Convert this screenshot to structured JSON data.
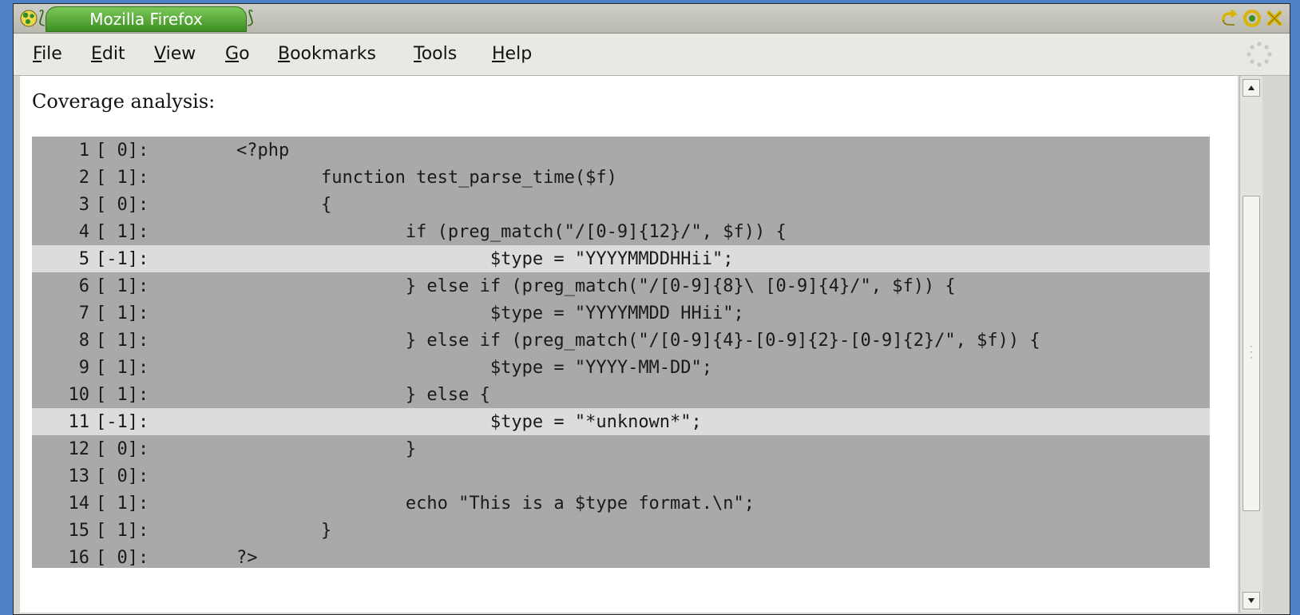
{
  "window": {
    "title": "Mozilla Firefox"
  },
  "menubar": {
    "items": [
      {
        "mnemonic": "F",
        "rest": "ile"
      },
      {
        "mnemonic": "E",
        "rest": "dit"
      },
      {
        "mnemonic": "V",
        "rest": "iew"
      },
      {
        "mnemonic": "G",
        "rest": "o"
      },
      {
        "mnemonic": "B",
        "rest": "ookmarks"
      },
      {
        "mnemonic": "T",
        "rest": "ools"
      },
      {
        "mnemonic": "H",
        "rest": "elp"
      }
    ]
  },
  "page": {
    "heading": "Coverage analysis:",
    "rows": [
      {
        "line": "1",
        "count": "[ 0]:",
        "code": "<?php",
        "uncovered": false
      },
      {
        "line": "2",
        "count": "[ 1]:",
        "code": "        function test_parse_time($f)",
        "uncovered": false
      },
      {
        "line": "3",
        "count": "[ 0]:",
        "code": "        {",
        "uncovered": false
      },
      {
        "line": "4",
        "count": "[ 1]:",
        "code": "                if (preg_match(\"/[0-9]{12}/\", $f)) {",
        "uncovered": false
      },
      {
        "line": "5",
        "count": "[-1]:",
        "code": "                        $type = \"YYYYMMDDHHii\";",
        "uncovered": true
      },
      {
        "line": "6",
        "count": "[ 1]:",
        "code": "                } else if (preg_match(\"/[0-9]{8}\\ [0-9]{4}/\", $f)) {",
        "uncovered": false
      },
      {
        "line": "7",
        "count": "[ 1]:",
        "code": "                        $type = \"YYYYMMDD HHii\";",
        "uncovered": false
      },
      {
        "line": "8",
        "count": "[ 1]:",
        "code": "                } else if (preg_match(\"/[0-9]{4}-[0-9]{2}-[0-9]{2}/\", $f)) {",
        "uncovered": false
      },
      {
        "line": "9",
        "count": "[ 1]:",
        "code": "                        $type = \"YYYY-MM-DD\";",
        "uncovered": false
      },
      {
        "line": "10",
        "count": "[ 1]:",
        "code": "                } else {",
        "uncovered": false
      },
      {
        "line": "11",
        "count": "[-1]:",
        "code": "                        $type = \"*unknown*\";",
        "uncovered": true
      },
      {
        "line": "12",
        "count": "[ 0]:",
        "code": "                }",
        "uncovered": false
      },
      {
        "line": "13",
        "count": "[ 0]:",
        "code": "",
        "uncovered": false
      },
      {
        "line": "14",
        "count": "[ 1]:",
        "code": "                echo \"This is a $type format.\\n\";",
        "uncovered": false
      },
      {
        "line": "15",
        "count": "[ 1]:",
        "code": "        }",
        "uncovered": false
      },
      {
        "line": "16",
        "count": "[ 0]:",
        "code": "?>",
        "uncovered": false
      }
    ]
  },
  "colors": {
    "covered_row": "#a9a9a9",
    "uncovered_row": "#dcdcdc",
    "title_tab": "#5cae3c",
    "desktop": "#4d83c4"
  },
  "icons": {
    "system_menu": "firefox-globe-icon",
    "window_buttons": [
      "minimize-icon",
      "maximize-icon",
      "close-icon"
    ],
    "throbber": "throbber-icon"
  }
}
